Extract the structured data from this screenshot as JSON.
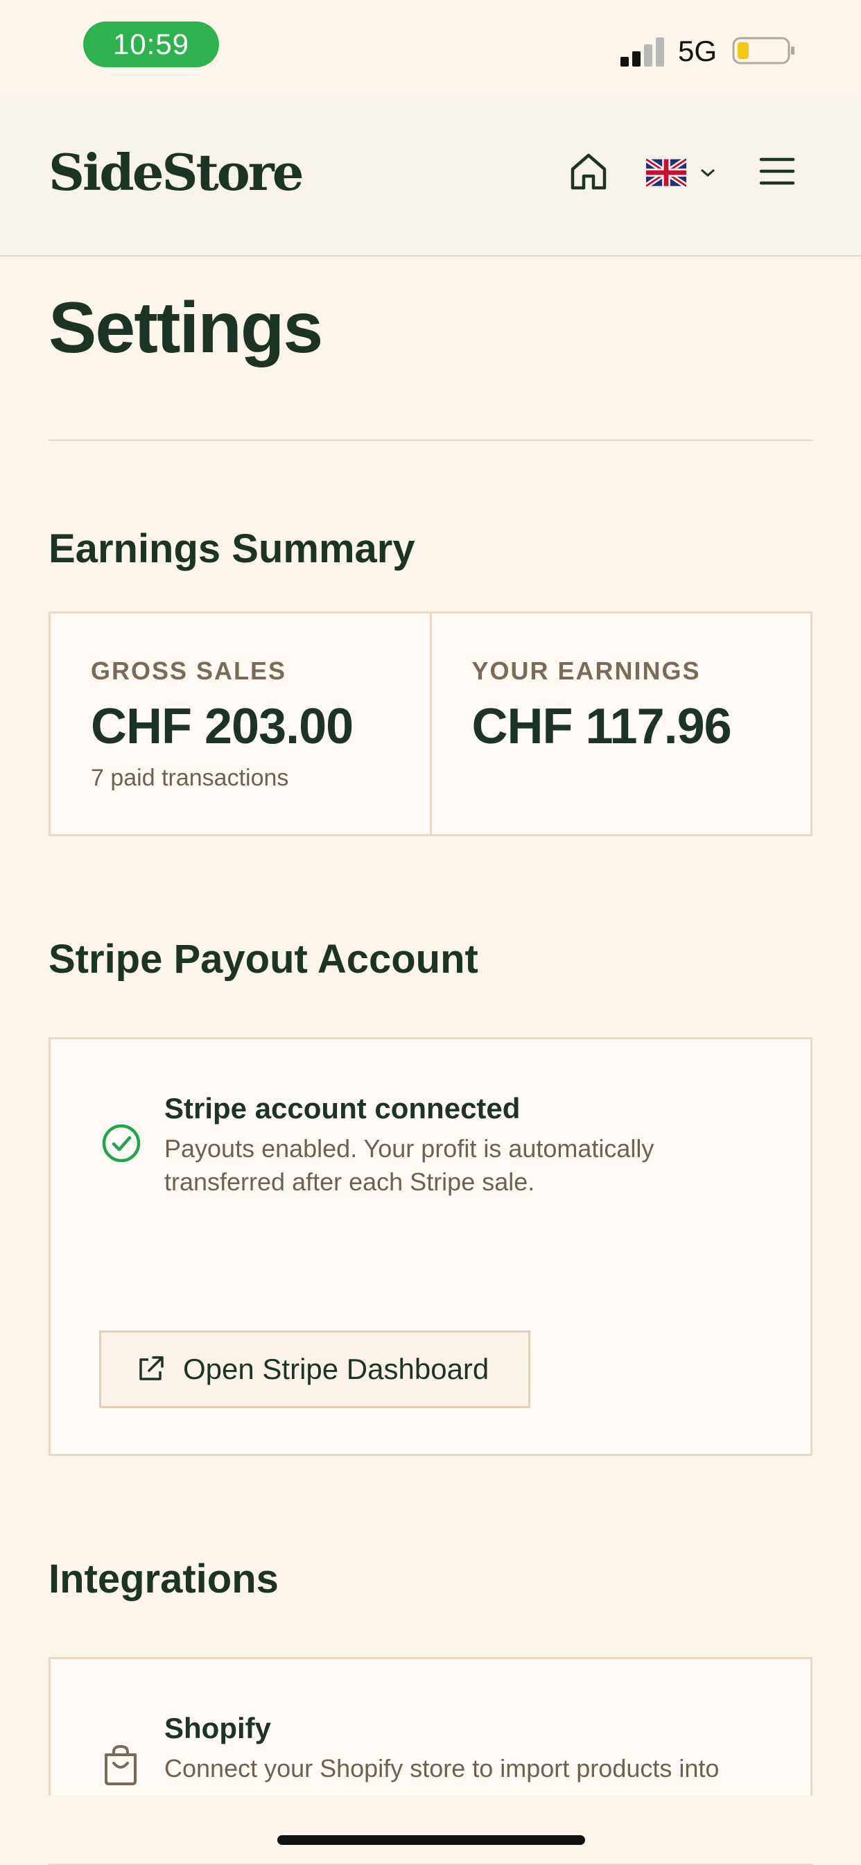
{
  "status_bar": {
    "time": "10:59",
    "network": "5G",
    "time_pill_color": "#2EB24D",
    "battery_color": "#F5C518"
  },
  "header": {
    "logo": "SideStore",
    "icons": [
      "home-icon",
      "uk-flag-icon",
      "chevron-down-icon",
      "hamburger-menu-icon"
    ]
  },
  "page": {
    "title": "Settings"
  },
  "earnings": {
    "heading": "Earnings Summary",
    "gross": {
      "label": "GROSS SALES",
      "value": "CHF 203.00",
      "sub": "7 paid transactions"
    },
    "yours": {
      "label": "YOUR EARNINGS",
      "value": "CHF 117.96"
    }
  },
  "stripe": {
    "heading": "Stripe Payout Account",
    "status_title": "Stripe account connected",
    "status_desc": "Payouts enabled. Your profit is automatically transferred after each Stripe sale.",
    "button_label": "Open Stripe Dashboard",
    "status_icon": "check-circle-icon",
    "status_color": "#22A447"
  },
  "integrations": {
    "heading": "Integrations",
    "items": [
      {
        "name": "Shopify",
        "desc": "Connect your Shopify store to import products into",
        "icon": "shopping-bag-icon"
      }
    ]
  },
  "colors": {
    "background": "#FBF5EC",
    "primary_text": "#1C3325",
    "border": "#EAD9C7"
  }
}
